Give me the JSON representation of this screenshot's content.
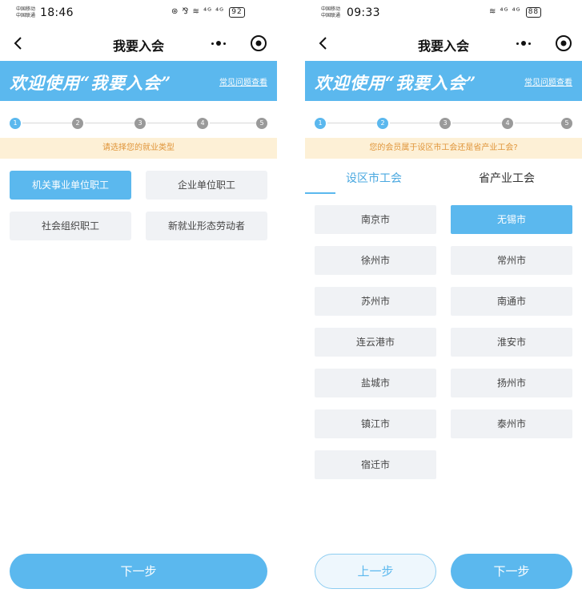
{
  "left_screen": {
    "status": {
      "carrier": [
        "中国移动",
        "中国联通"
      ],
      "time": "18:46",
      "icons": "⊛ ⅋ ≋ ⁴ᴳ ⁴ᴳ",
      "battery": "92"
    },
    "nav": {
      "title": "我要入会"
    },
    "banner": {
      "title": "欢迎使用“我要入会”",
      "link": "常见问题查看"
    },
    "steps": [
      "1",
      "2",
      "3",
      "4",
      "5"
    ],
    "hint": "请选择您的就业类型",
    "options": [
      "机关事业单位职工",
      "企业单位职工",
      "社会组织职工",
      "新就业形态劳动者"
    ],
    "selected_option": "机关事业单位职工",
    "next_button": "下一步"
  },
  "right_screen": {
    "status": {
      "carrier": [
        "中国移动",
        "中国联通"
      ],
      "time": "09:33",
      "icons": "≋ ⁴ᴳ ⁴ᴳ",
      "battery": "88"
    },
    "nav": {
      "title": "我要入会"
    },
    "banner": {
      "title": "欢迎使用“我要入会”",
      "link": "常见问题查看"
    },
    "steps": [
      "1",
      "2",
      "3",
      "4",
      "5"
    ],
    "hint": "您的会员属于设区市工会还是省产业工会?",
    "tabs": [
      "设区市工会",
      "省产业工会"
    ],
    "cities": [
      "南京市",
      "无锡市",
      "徐州市",
      "常州市",
      "苏州市",
      "南通市",
      "连云港市",
      "淮安市",
      "盐城市",
      "扬州市",
      "镇江市",
      "泰州市",
      "宿迁市"
    ],
    "selected_city": "无锡市",
    "prev_button": "上一步",
    "next_button": "下一步"
  },
  "colors": {
    "accent": "#5bb8ee",
    "hint_bg": "#fdf0d6",
    "hint_text": "#e0953a",
    "option_bg": "#f0f2f5"
  }
}
